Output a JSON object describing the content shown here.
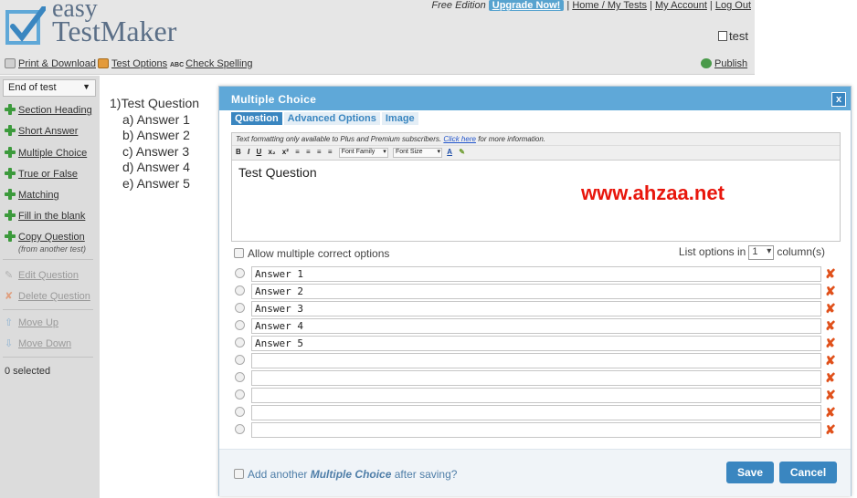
{
  "header": {
    "logo_top": "easy",
    "logo_bottom": "TestMaker",
    "edition": "Free Edition",
    "upgrade": "Upgrade Now!",
    "home_link": "Home / My Tests",
    "account_link": "My Account",
    "logout_link": "Log Out",
    "test_name": "test"
  },
  "toolbar": {
    "print": "Print & Download",
    "options": "Test Options",
    "spell_abc": "ABC",
    "spelling": "Check Spelling",
    "publish": "Publish"
  },
  "sidebar": {
    "insert_position": "End of test",
    "add_items": [
      {
        "label": "Section Heading"
      },
      {
        "label": "Short Answer"
      },
      {
        "label": "Multiple Choice"
      },
      {
        "label": "True or False"
      },
      {
        "label": "Matching"
      },
      {
        "label": "Fill in the blank"
      },
      {
        "label": "Copy Question"
      }
    ],
    "copy_sub": "(from another test)",
    "edit_question": "Edit Question",
    "delete_question": "Delete Question",
    "move_up": "Move Up",
    "move_down": "Move Down",
    "selected": "0 selected"
  },
  "preview": {
    "question": "1)Test Question",
    "answers": [
      "a) Answer 1",
      "b) Answer 2",
      "c) Answer 3",
      "d) Answer 4",
      "e) Answer 5"
    ]
  },
  "modal": {
    "title": "Multiple Choice",
    "close": "x",
    "tabs": [
      "Question",
      "Advanced Options",
      "Image"
    ],
    "note_prefix": "Text formatting only available to Plus and Premium subscribers.",
    "note_link": "Click here",
    "note_suffix": "for more information.",
    "font_family": "Font Family",
    "font_size": "Font Size",
    "editor_text": "Test Question",
    "allow_multiple": "Allow multiple correct options",
    "list_options_prefix": "List options in",
    "columns_value": "1",
    "list_options_suffix": "column(s)",
    "answers": [
      "Answer 1",
      "Answer 2",
      "Answer 3",
      "Answer 4",
      "Answer 5",
      "",
      "",
      "",
      "",
      ""
    ],
    "add_another_prefix": "Add another",
    "add_another_type": "Multiple Choice",
    "add_another_suffix": "after saving?",
    "save": "Save",
    "cancel": "Cancel"
  },
  "watermark": "www.ahzaa.net",
  "colors": {
    "accent": "#3a86c0",
    "title_bar": "#5fa8d8",
    "delete": "#e0501a",
    "add_green": "#3c9a3c"
  }
}
